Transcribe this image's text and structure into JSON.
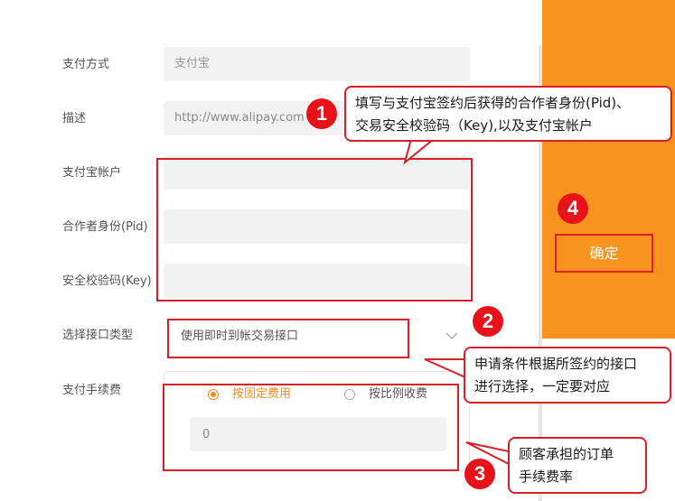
{
  "form": {
    "payment_method": {
      "label": "支付方式",
      "value": "支付宝"
    },
    "description": {
      "label": "描述",
      "value": "http://www.alipay.com"
    },
    "alipay_account": {
      "label": "支付宝帐户",
      "value": ""
    },
    "partner_id": {
      "label": "合作者身份(Pid)",
      "value": ""
    },
    "security_key": {
      "label": "安全校验码(Key)",
      "value": ""
    },
    "interface_type": {
      "label": "选择接口类型",
      "selected": "使用即时到帐交易接口"
    },
    "fee": {
      "label": "支付手续费",
      "options": [
        {
          "label": "按固定费用",
          "checked": true
        },
        {
          "label": "按比例收费",
          "checked": false
        }
      ],
      "value": "0"
    }
  },
  "confirm_label": "确定",
  "annotations": {
    "badges": [
      "1",
      "2",
      "3",
      "4"
    ],
    "callout1": [
      "填写与支付宝签约后获得的合作者身份(Pid)、",
      "交易安全校验码（Key),以及支付宝帐户"
    ],
    "callout2": [
      "申请条件根据所签约的接口",
      "进行选择，一定要对应"
    ],
    "callout3": [
      "顾客承担的订单",
      "手续费率"
    ]
  },
  "colors": {
    "accent": "#f7931e",
    "annotation_red": "#d61f26",
    "radio_accent": "#f08c1e"
  }
}
